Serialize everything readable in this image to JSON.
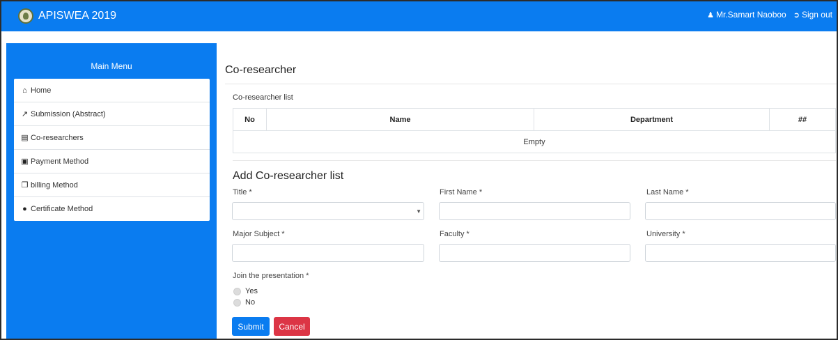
{
  "header": {
    "app_title": "APISWEA 2019",
    "user_name": "Mr.Samart  Naoboo",
    "sign_out_label": "Sign out",
    "user_icon": "user-icon",
    "sign_out_icon": "sign-out-icon"
  },
  "sidebar": {
    "title": "Main Menu",
    "items": [
      {
        "label": "Home",
        "icon": "home-icon"
      },
      {
        "label": "Submission (Abstract)",
        "icon": "share-icon"
      },
      {
        "label": "Co-researchers",
        "icon": "id-card-icon"
      },
      {
        "label": "Payment Method",
        "icon": "money-icon"
      },
      {
        "label": "billing Method",
        "icon": "copy-icon"
      },
      {
        "label": "Certificate Method",
        "icon": "circle-icon"
      }
    ]
  },
  "main": {
    "title": "Co-researcher",
    "list_label": "Co-researcher list",
    "table": {
      "columns": [
        "No",
        "Name",
        "Department",
        "##"
      ],
      "empty_text": "Empty"
    },
    "form": {
      "title": "Add Co-researcher list",
      "fields": {
        "title_label": "Title *",
        "first_name_label": "First Name *",
        "last_name_label": "Last Name *",
        "major_label": "Major Subject *",
        "faculty_label": "Faculty *",
        "university_label": "University *",
        "title_value": "",
        "first_name_value": "",
        "last_name_value": "",
        "major_value": "",
        "faculty_value": "",
        "university_value": ""
      },
      "join_label": "Join the presentation *",
      "join_options": [
        "Yes",
        "No"
      ],
      "submit_label": "Submit",
      "cancel_label": "Cancel"
    }
  },
  "colors": {
    "primary": "#0a7cf0",
    "danger": "#dc3545"
  }
}
